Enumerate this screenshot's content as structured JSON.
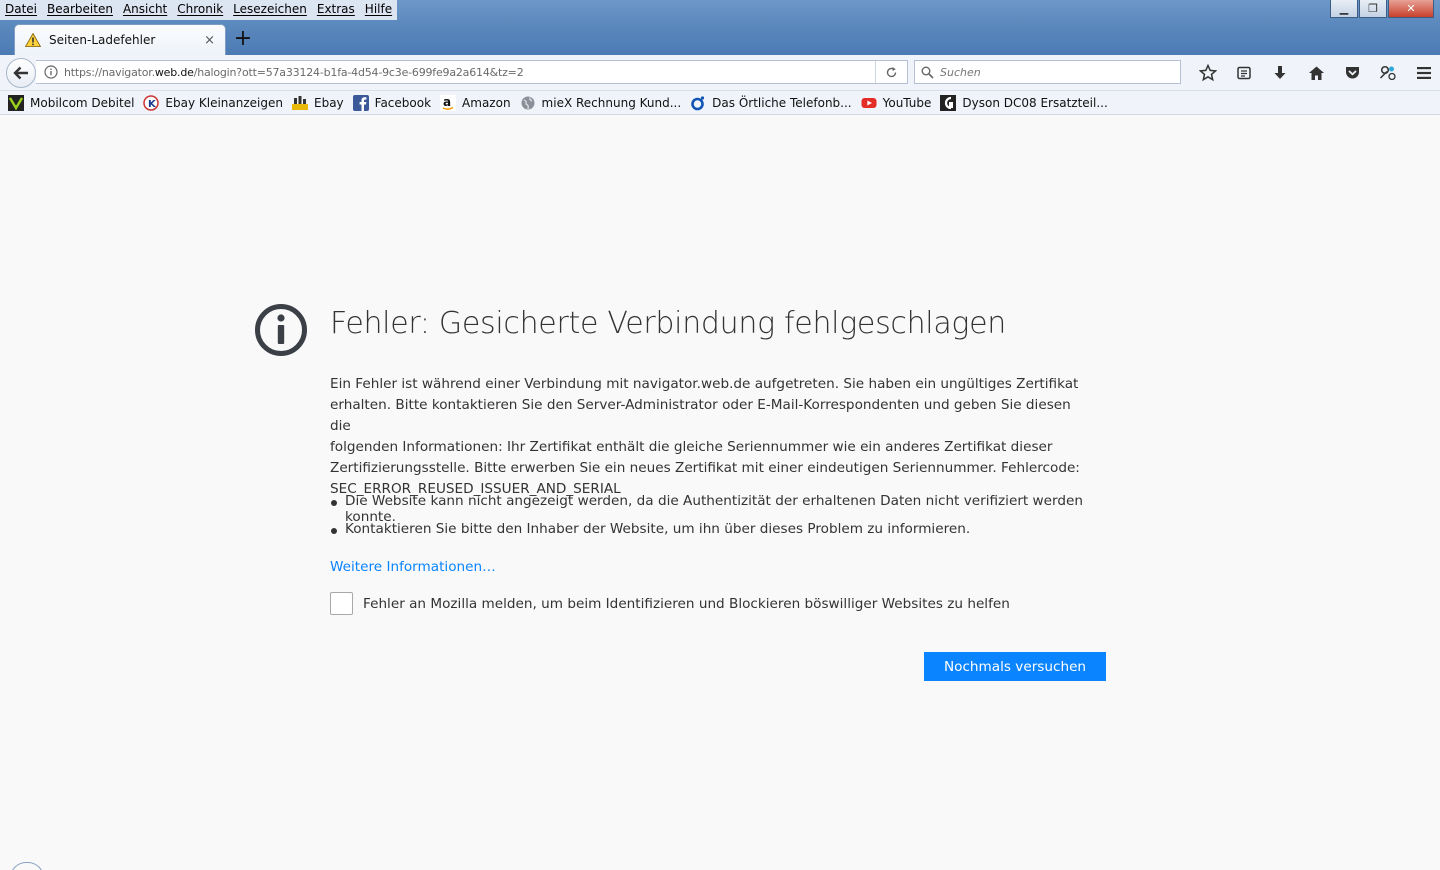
{
  "menu": [
    "Datei",
    "Bearbeiten",
    "Ansicht",
    "Chronik",
    "Lesezeichen",
    "Extras",
    "Hilfe"
  ],
  "tab": {
    "title": "Seiten-Ladefehler",
    "close": "×",
    "new": "+"
  },
  "window": {
    "minimize": "▁",
    "maximize": "❐",
    "close": "✕"
  },
  "address": {
    "prefix": "https://navigator.",
    "domain": "web.de",
    "suffix": "/halogin?ott=57a33124-b1fa-4d54-9c3e-699fe9a2a614&tz=2"
  },
  "search": {
    "placeholder": "Suchen"
  },
  "toolbar_icons": [
    "star-icon",
    "reading-list-icon",
    "download-icon",
    "home-icon",
    "pocket-icon",
    "extension-icon",
    "menu-icon"
  ],
  "bookmarks": [
    {
      "label": "Mobilcom Debitel",
      "icon": "mobilcom-icon"
    },
    {
      "label": "Ebay Kleinanzeigen",
      "icon": "kleinanzeigen-icon"
    },
    {
      "label": "Ebay",
      "icon": "ebay-icon"
    },
    {
      "label": "Facebook",
      "icon": "facebook-icon"
    },
    {
      "label": "Amazon",
      "icon": "amazon-icon"
    },
    {
      "label": "mieX Rechnung Kund...",
      "icon": "globe-icon"
    },
    {
      "label": "Das Örtliche Telefonb...",
      "icon": "oertliche-icon"
    },
    {
      "label": "YouTube",
      "icon": "youtube-icon"
    },
    {
      "label": "Dyson DC08 Ersatzteil...",
      "icon": "dyson-icon"
    }
  ],
  "error": {
    "title": "Fehler: Gesicherte Verbindung fehlgeschlagen",
    "description_lines": [
      "Ein Fehler ist während einer Verbindung mit navigator.web.de aufgetreten. Sie haben ein ungültiges Zertifikat",
      "erhalten. Bitte kontaktieren Sie den Server-Administrator oder E-Mail-Korrespondenten und geben Sie diesen die",
      "folgenden Informationen: Ihr Zertifikat enthält die gleiche Seriennummer wie ein anderes Zertifikat dieser",
      "Zertifizierungsstelle. Bitte erwerben Sie ein neues Zertifikat mit einer eindeutigen Seriennummer. Fehlercode:",
      "SEC_ERROR_REUSED_ISSUER_AND_SERIAL"
    ],
    "bullets": [
      "Die Website kann nicht angezeigt werden, da die Authentizität der erhaltenen Daten nicht verifiziert werden konnte.",
      "Kontaktieren Sie bitte den Inhaber der Website, um ihn über dieses Problem zu informieren."
    ],
    "more_info": "Weitere Informationen…",
    "report_label": "Fehler an Mozilla melden, um beim Identifizieren und Blockieren böswilliger Websites zu helfen",
    "retry_button": "Nochmals versuchen"
  },
  "colors": {
    "accent": "#0a84ff",
    "text": "#333333",
    "background": "#f9f9fa"
  }
}
